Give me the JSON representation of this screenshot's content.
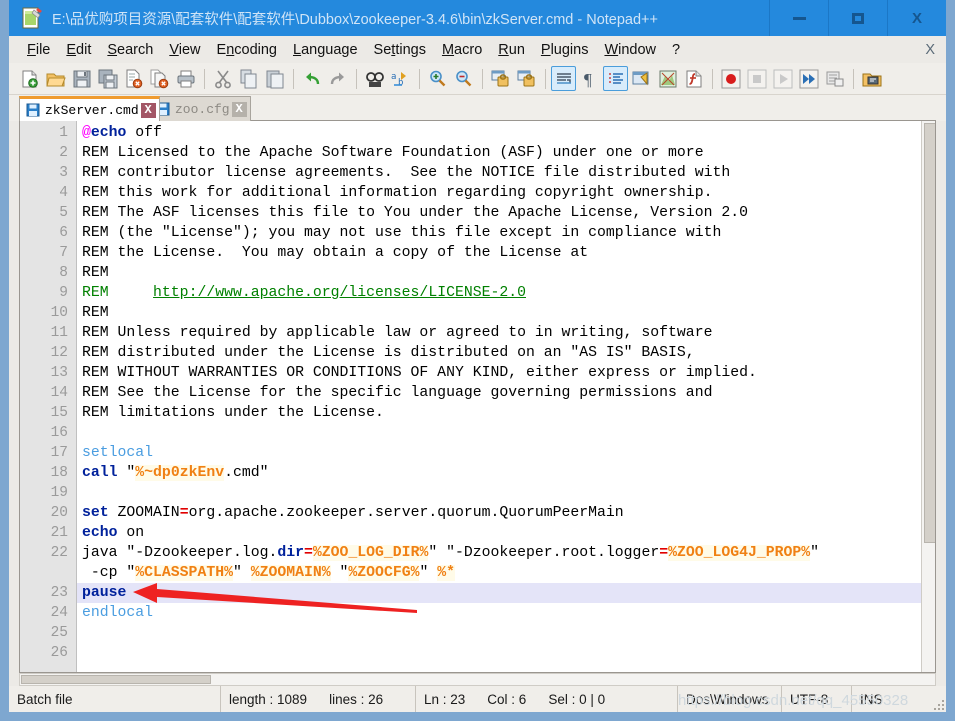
{
  "window": {
    "title": "E:\\品优购项目资源\\配套软件\\配套软件\\Dubbox\\zookeeper-3.4.6\\bin\\zkServer.cmd - Notepad++",
    "icon": "notepad-plus-plus-icon",
    "minimize_label": "",
    "maximize_label": "",
    "close_label": "X"
  },
  "menu": {
    "items": [
      {
        "label": "File",
        "accel": "F"
      },
      {
        "label": "Edit",
        "accel": "E"
      },
      {
        "label": "Search",
        "accel": "S"
      },
      {
        "label": "View",
        "accel": "V"
      },
      {
        "label": "Encoding",
        "accel": "n"
      },
      {
        "label": "Language",
        "accel": "L"
      },
      {
        "label": "Settings",
        "accel": "t"
      },
      {
        "label": "Macro",
        "accel": "M"
      },
      {
        "label": "Run",
        "accel": "R"
      },
      {
        "label": "Plugins",
        "accel": "P"
      },
      {
        "label": "Window",
        "accel": "W"
      },
      {
        "label": "?",
        "accel": ""
      }
    ],
    "close_doc_label": "X"
  },
  "toolbar": {
    "buttons": [
      "new-file-icon",
      "open-file-icon",
      "save-icon",
      "save-all-icon",
      "close-file-icon",
      "close-all-files-icon",
      "print-icon",
      "cut-icon",
      "copy-icon",
      "paste-icon",
      "undo-icon",
      "redo-icon",
      "find-icon",
      "replace-icon",
      "zoom-in-icon",
      "zoom-out-icon",
      "sync-vertical-scroll-icon",
      "sync-horizontal-scroll-icon",
      "word-wrap-icon",
      "show-all-characters-icon",
      "show-indent-guide-icon",
      "user-defined-dialog-icon",
      "document-map-icon",
      "function-list-icon",
      "start-record-macro-icon",
      "stop-record-macro-icon",
      "play-macro-icon",
      "run-macro-multiple-icon",
      "save-macro-icon",
      "run-icon"
    ]
  },
  "tabs": [
    {
      "label": "zkServer.cmd",
      "icon": "saved-file-icon",
      "close": "X",
      "active": true
    },
    {
      "label": "zoo.cfg",
      "icon": "saved-file-icon",
      "close": "X",
      "active": false
    }
  ],
  "editor": {
    "current_line": 23,
    "line_numbers": [
      1,
      2,
      3,
      4,
      5,
      6,
      7,
      8,
      9,
      10,
      11,
      12,
      13,
      14,
      15,
      16,
      17,
      18,
      19,
      20,
      21,
      22,
      "",
      23,
      24,
      25,
      26
    ],
    "lines": [
      "@echo off",
      "REM Licensed to the Apache Software Foundation (ASF) under one or more",
      "REM contributor license agreements.  See the NOTICE file distributed with",
      "REM this work for additional information regarding copyright ownership.",
      "REM The ASF licenses this file to You under the Apache License, Version 2.0",
      "REM (the \"License\"); you may not use this file except in compliance with",
      "REM the License.  You may obtain a copy of the License at",
      "REM",
      "REM     http://www.apache.org/licenses/LICENSE-2.0",
      "REM",
      "REM Unless required by applicable law or agreed to in writing, software",
      "REM distributed under the License is distributed on an \"AS IS\" BASIS,",
      "REM WITHOUT WARRANTIES OR CONDITIONS OF ANY KIND, either express or implied.",
      "REM See the License for the specific language governing permissions and",
      "REM limitations under the License.",
      "",
      "setlocal",
      "call \"%~dp0zkEnv.cmd\"",
      "",
      "set ZOOMAIN=org.apache.zookeeper.server.quorum.QuorumPeerMain",
      "echo on",
      "java \"-Dzookeeper.log.dir=%ZOO_LOG_DIR%\" \"-Dzookeeper.root.logger=%ZOO_LOG4J_PROP%\"",
      " -cp \"%CLASSPATH%\" %ZOOMAIN% \"%ZOOCFG%\" %*",
      "pause",
      "endlocal",
      "",
      ""
    ],
    "url_line_9": "http://www.apache.org/licenses/LICENSE-2.0"
  },
  "annotation": {
    "arrow_color": "#ee2222",
    "points_to": "pause"
  },
  "statusbar": {
    "file_type": "Batch file",
    "length_label": "length : 1089",
    "lines_label": "lines : 26",
    "ln": "Ln : 23",
    "col": "Col : 6",
    "sel": "Sel : 0 | 0",
    "eol": "Dos\\Windows",
    "encoding": "UTF-8",
    "insert_mode": "INS"
  },
  "watermark": "https://blog.csdn.net/qq_45550328",
  "colors": {
    "titlebar": "#2489dd",
    "comment_green": "#008000",
    "keyword_blue": "#00219b",
    "variable_orange": "#f08013",
    "operator_red": "#e00000",
    "current_line": "#e4e4f8",
    "accent_tab": "#ef9b2f"
  }
}
